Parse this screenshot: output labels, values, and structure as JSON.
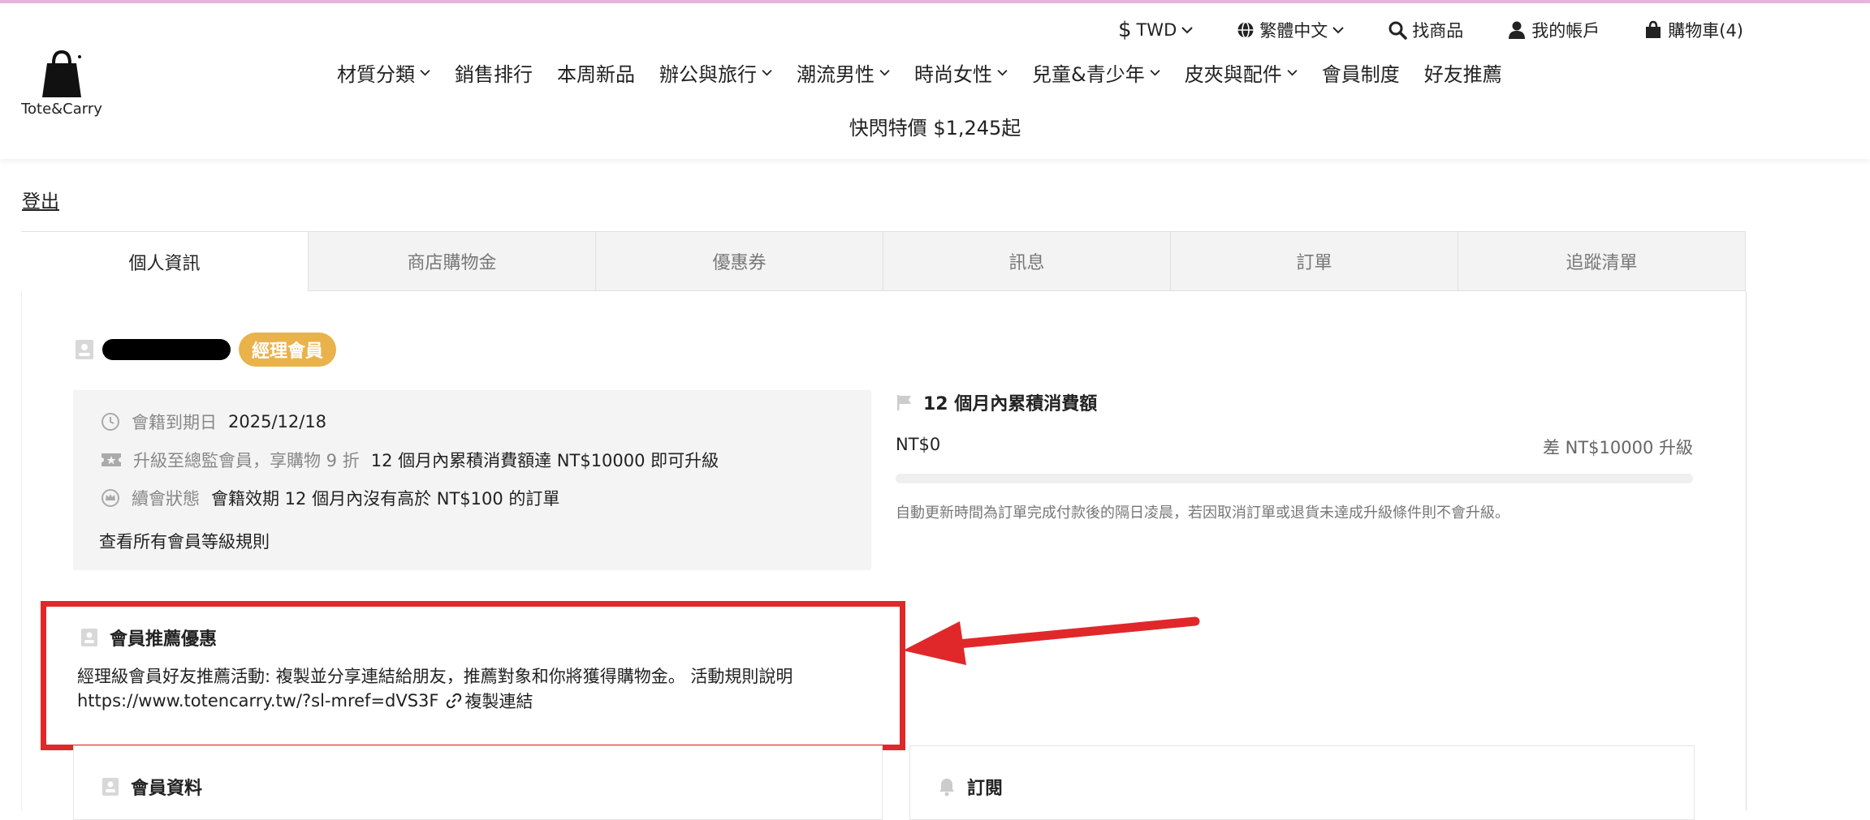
{
  "brand": {
    "logo_text": "Tote&Carry"
  },
  "utility": {
    "currency": "TWD",
    "language": "繁體中文",
    "search": "找商品",
    "account": "我的帳戶",
    "cart": "購物車(4)"
  },
  "nav": {
    "items": [
      {
        "label": "材質分類",
        "dropdown": true
      },
      {
        "label": "銷售排行",
        "dropdown": false
      },
      {
        "label": "本周新品",
        "dropdown": false
      },
      {
        "label": "辦公與旅行",
        "dropdown": true
      },
      {
        "label": "潮流男性",
        "dropdown": true
      },
      {
        "label": "時尚女性",
        "dropdown": true
      },
      {
        "label": "兒童&青少年",
        "dropdown": true
      },
      {
        "label": "皮夾與配件",
        "dropdown": true
      },
      {
        "label": "會員制度",
        "dropdown": false
      },
      {
        "label": "好友推薦",
        "dropdown": false
      }
    ],
    "flash_sale": "快閃特價 $1,245起"
  },
  "logout": "登出",
  "tabs": [
    "個人資訊",
    "商店購物金",
    "優惠券",
    "訊息",
    "訂單",
    "追蹤清單"
  ],
  "member": {
    "level_badge": "經理會員",
    "expiry_label": "會籍到期日",
    "expiry_value": "2025/12/18",
    "upgrade_label": "升級至總監會員，享購物 9 折",
    "upgrade_value": "12 個月內累積消費額達 NT$10000 即可升級",
    "renew_label": "續會狀態",
    "renew_value": "會籍效期 12 個月內沒有高於 NT$100 的訂單",
    "rules_link": "查看所有會員等級規則"
  },
  "spending": {
    "title": "12 個月內累積消費額",
    "amount": "NT$0",
    "remaining": "差 NT$10000 升級",
    "progress": 0,
    "note": "自動更新時間為訂單完成付款後的隔日凌晨，若因取消訂單或退貨未達成升級條件則不會升級。"
  },
  "referral": {
    "title": "會員推薦優惠",
    "description": "經理級會員好友推薦活動: 複製並分享連結給朋友，推薦對象和你將獲得購物金。 活動規則說明",
    "url": "https://www.totencarry.tw/?sl-mref=dVS3F",
    "copy_label": "複製連結"
  },
  "sections": {
    "profile_title": "會員資料",
    "subscribe_title": "訂閱"
  },
  "colors": {
    "accent": "#e9b24b",
    "highlight_red": "#e0282a",
    "top_line": "#e8b4de"
  }
}
